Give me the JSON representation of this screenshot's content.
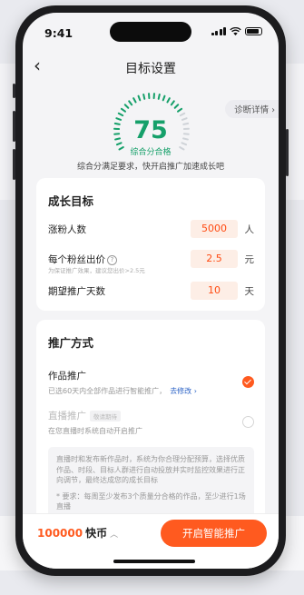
{
  "status_bar": {
    "time": "9:41"
  },
  "nav": {
    "back_icon": "chevron-left-icon",
    "title": "目标设置"
  },
  "diagnosis": {
    "label": "诊断详情"
  },
  "score": {
    "value": "75",
    "grade": "综合分合格",
    "level_fraction": 0.75,
    "summary": "综合分满足要求，快开启推广加速成长吧"
  },
  "growth": {
    "title": "成长目标",
    "rows": [
      {
        "label": "涨粉人数",
        "value": "5000",
        "unit": "人",
        "hint": ""
      },
      {
        "label": "每个粉丝出价",
        "value": "2.5",
        "unit": "元",
        "hint": "为保证推广效果，建议您出价>2.5元"
      },
      {
        "label": "期望推广天数",
        "value": "10",
        "unit": "天",
        "hint": ""
      }
    ]
  },
  "promo": {
    "title": "推广方式",
    "options": [
      {
        "title": "作品推广",
        "desc": "已选60天内全部作品进行智能推广，",
        "link": "去修改",
        "selected": true
      },
      {
        "title": "直播推广",
        "tag": "敬请期待",
        "desc": "在您直播时系统自动开启推广",
        "selected": false
      }
    ],
    "info": [
      "直播时和发布新作品时，系统为你合理分配预算，选择优质作品、时段、目标人群进行自动投放并实时监控效果进行正向调节，最终达成您的成长目标",
      "* 要求：每周至少发布3个质量分合格的作品，至少进行1场直播"
    ]
  },
  "footer": {
    "amount": "100000",
    "unit": "快币",
    "button": "开启智能推广"
  },
  "colors": {
    "accent": "#ff5a1f",
    "score_green": "#16a06a",
    "link_blue": "#2c63c6"
  }
}
